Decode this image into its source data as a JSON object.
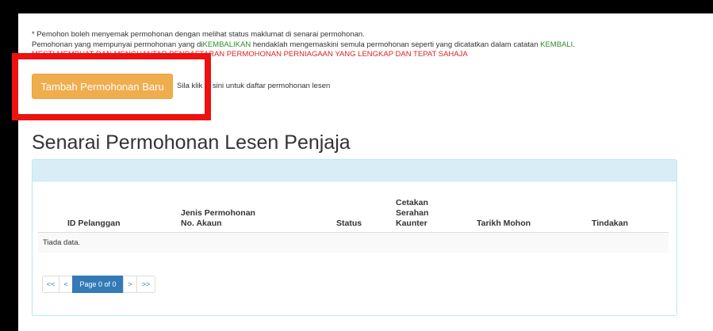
{
  "notes": {
    "line1": "* Pemohon boleh menyemak permohonan dengan melihat status maklumat di senarai permohonan.",
    "line2_pre": "Pemohonan yang mempunyai permohonan yang di",
    "line2_green1": "KEMBALIKAN",
    "line2_mid": " hendaklah mengemaskini semula permohonan seperti yang dicatatkan dalam catatan ",
    "line2_green2": "KEMBALI",
    "line2_post": ".",
    "line3": "MESTI MEMBUAT DAN MENGHANTAR PENDAFTARAN PERMOHONAN PERNIAGAAN YANG LENGKAP DAN TEPAT SAHAJA"
  },
  "add_button": {
    "label": "Tambah Permohonan Baru"
  },
  "hint": "Sila klik di sini untuk daftar permohonan lesen",
  "page_title": "Senarai Permohonan Lesen Penjaja",
  "table": {
    "headers": {
      "id": "ID Pelanggan",
      "jenis_line1": "Jenis Permohonan",
      "jenis_line2": "No. Akaun",
      "status": "Status",
      "cetakan_line1": "Cetakan",
      "cetakan_line2": "Serahan",
      "cetakan_line3": "Kaunter",
      "tarikh": "Tarikh Mohon",
      "tindakan": "Tindakan"
    },
    "empty_text": "Tiada data."
  },
  "pager": {
    "first": "<<",
    "prev": "<",
    "page_label": "Page 0 of 0",
    "next": ">",
    "last": ">>"
  },
  "colors": {
    "accent_button": "#f0ad4e",
    "highlight_box": "#ee1111",
    "panel_heading": "#d9edf7",
    "pager_active": "#337ab7"
  }
}
